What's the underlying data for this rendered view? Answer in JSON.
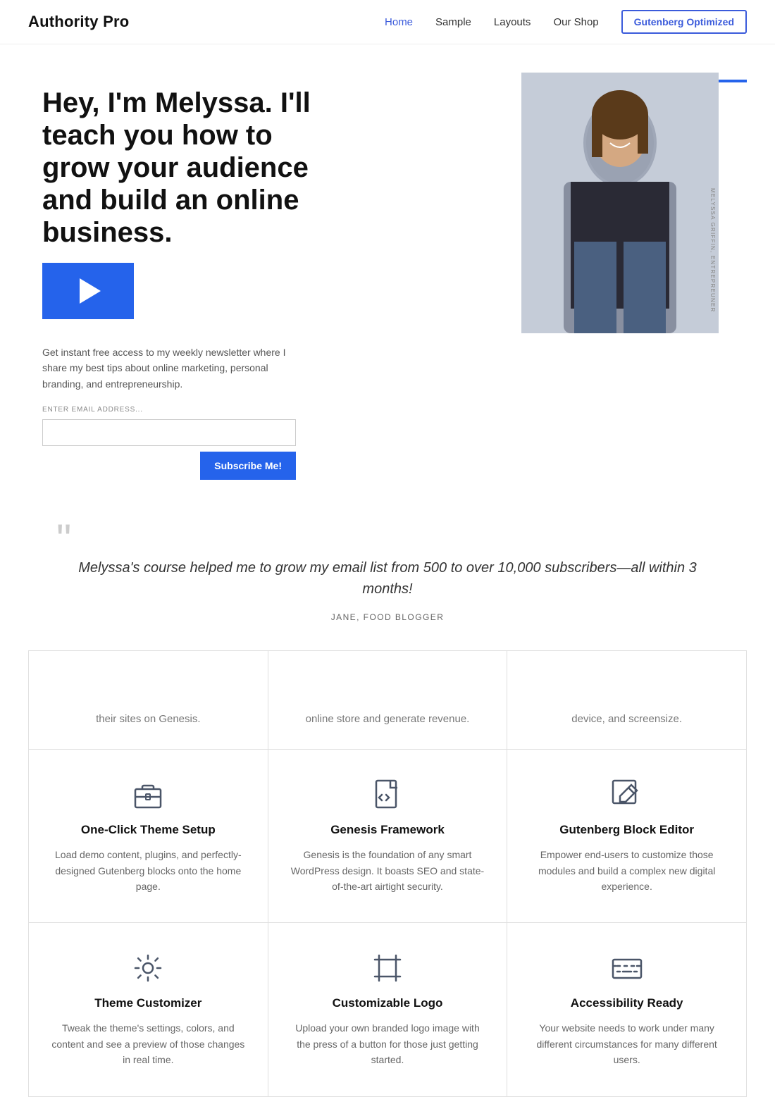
{
  "header": {
    "logo": "Authority Pro",
    "nav": {
      "items": [
        {
          "label": "Home",
          "active": true
        },
        {
          "label": "Sample",
          "active": false
        },
        {
          "label": "Layouts",
          "active": false
        },
        {
          "label": "Our Shop",
          "active": false
        }
      ],
      "button_label": "Gutenberg Optimized"
    }
  },
  "hero": {
    "title": "Hey, I'm Melyssa. I'll teach you how to grow your audience and build an online business.",
    "subtitle": "Get instant free access to my weekly newsletter where I share my best tips about online marketing, personal branding, and entrepreneurship.",
    "email_placeholder": "ENTER EMAIL ADDRESS...",
    "subscribe_label": "Subscribe Me!",
    "person_label": "MELYSSA GRIFFIN, ENTREPREUNER"
  },
  "testimonial": {
    "quote": "Melyssa's course helped me to grow my email list from 500 to over 10,000 subscribers—all within 3 months!",
    "author": "JANE, FOOD BLOGGER"
  },
  "features": {
    "partial_row": [
      {
        "text": "their sites on Genesis."
      },
      {
        "text": "online store and generate revenue."
      },
      {
        "text": "device, and screensize."
      }
    ],
    "main_row": [
      {
        "icon": "briefcase",
        "title": "One-Click Theme Setup",
        "desc": "Load demo content, plugins, and perfectly-designed Gutenberg blocks onto the home page."
      },
      {
        "icon": "code-file",
        "title": "Genesis Framework",
        "desc": "Genesis is the foundation of any smart WordPress design. It boasts SEO and state-of-the-art airtight security."
      },
      {
        "icon": "edit",
        "title": "Gutenberg Block Editor",
        "desc": "Empower end-users to customize those modules and build a complex new digital experience."
      }
    ],
    "bottom_row": [
      {
        "icon": "gear",
        "title": "Theme Customizer",
        "desc": "Tweak the theme's settings, colors, and content and see a preview of those changes in real time."
      },
      {
        "icon": "frame",
        "title": "Customizable Logo",
        "desc": "Upload your own branded logo image with the press of a button for those just getting started."
      },
      {
        "icon": "keyboard",
        "title": "Accessibility Ready",
        "desc": "Your website needs to work under many different circumstances for many different users."
      }
    ]
  }
}
